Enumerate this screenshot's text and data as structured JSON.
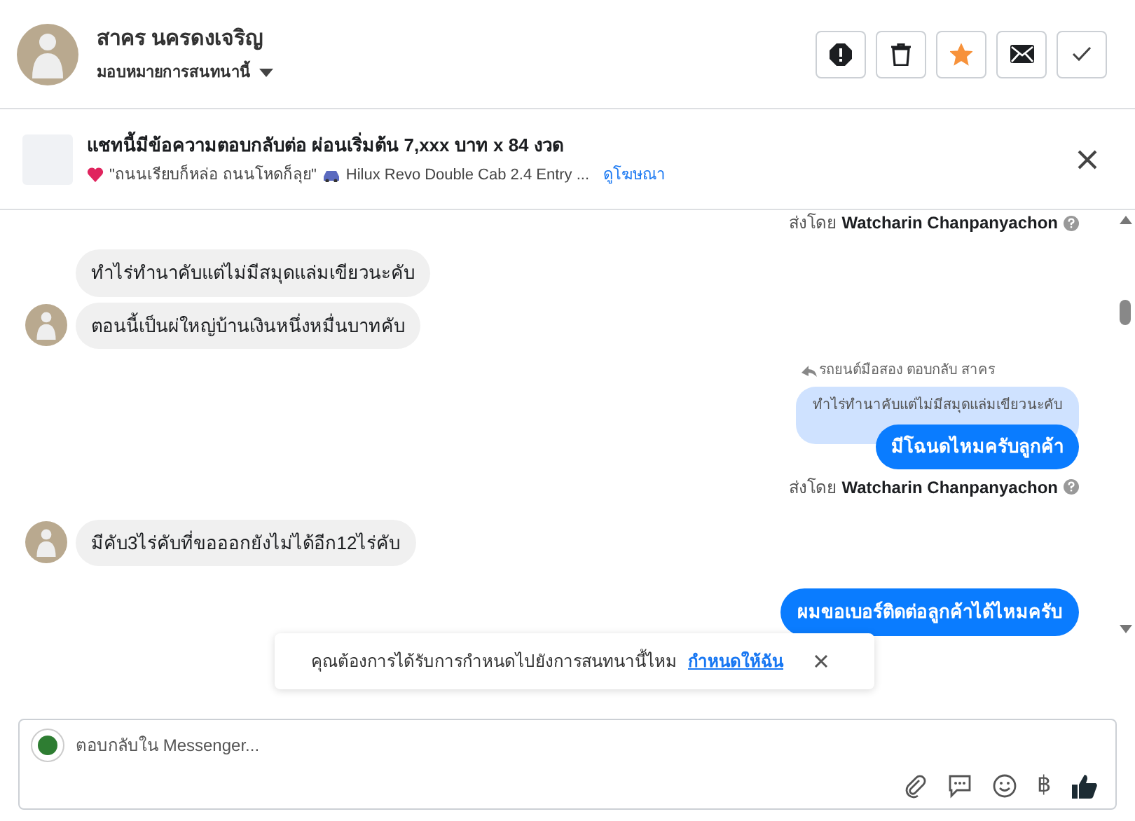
{
  "header": {
    "name": "สาคร นครดงเจริญ",
    "assign_label": "มอบหมายการสนทนานี้",
    "starred": true
  },
  "ad": {
    "title": "แชทนี้มีข้อความตอบกลับต่อ ผ่อนเริ่มต้น 7,xxx บาท x 84 งวด",
    "caption": "\"ถนนเรียบก็หล่อ ถนนโหดก็ลุย\"",
    "vehicle": "Hilux Revo Double Cab 2.4 Entry ...",
    "link": "ดูโฆษณา"
  },
  "messages": [
    {
      "kind": "sent_by",
      "label": "ส่งโดย",
      "sender": "Watcharin Chanpanyachon"
    },
    {
      "kind": "incoming",
      "text": "ทำไร่ทำนาคับแต่ไม่มีสมุดแล่มเขียวนะคับ",
      "avatar": false
    },
    {
      "kind": "incoming",
      "text": "ตอนนี้เป็นผ่ใหญ่บ้านเงินหนึ่งหมื่นบาทคับ",
      "avatar": true
    },
    {
      "kind": "reply",
      "label": "รถยนต์มือสอง ตอบกลับ สาคร",
      "quote": "ทำไร่ทำนาคับแต่ไม่มีสมุดแล่มเขียวนะคับ",
      "text": "มีโฉนดไหมครับลูกค้า"
    },
    {
      "kind": "sent_by",
      "label": "ส่งโดย",
      "sender": "Watcharin Chanpanyachon"
    },
    {
      "kind": "incoming",
      "text": "มีคับ3ไร่คับที่ขอออกยังไม่ได้อีก12ไร่คับ",
      "avatar": true
    },
    {
      "kind": "outgoing",
      "text": "ผมขอเบอร์ติดต่อลูกค้าได้ไหมครับ"
    }
  ],
  "prompt": {
    "text": "คุณต้องการได้รับการกำหนดไปยังการสนทนานี้ไหม",
    "link": "กำหนดให้ฉัน"
  },
  "composer": {
    "placeholder": "ตอบกลับใน Messenger...",
    "baht": "฿"
  }
}
